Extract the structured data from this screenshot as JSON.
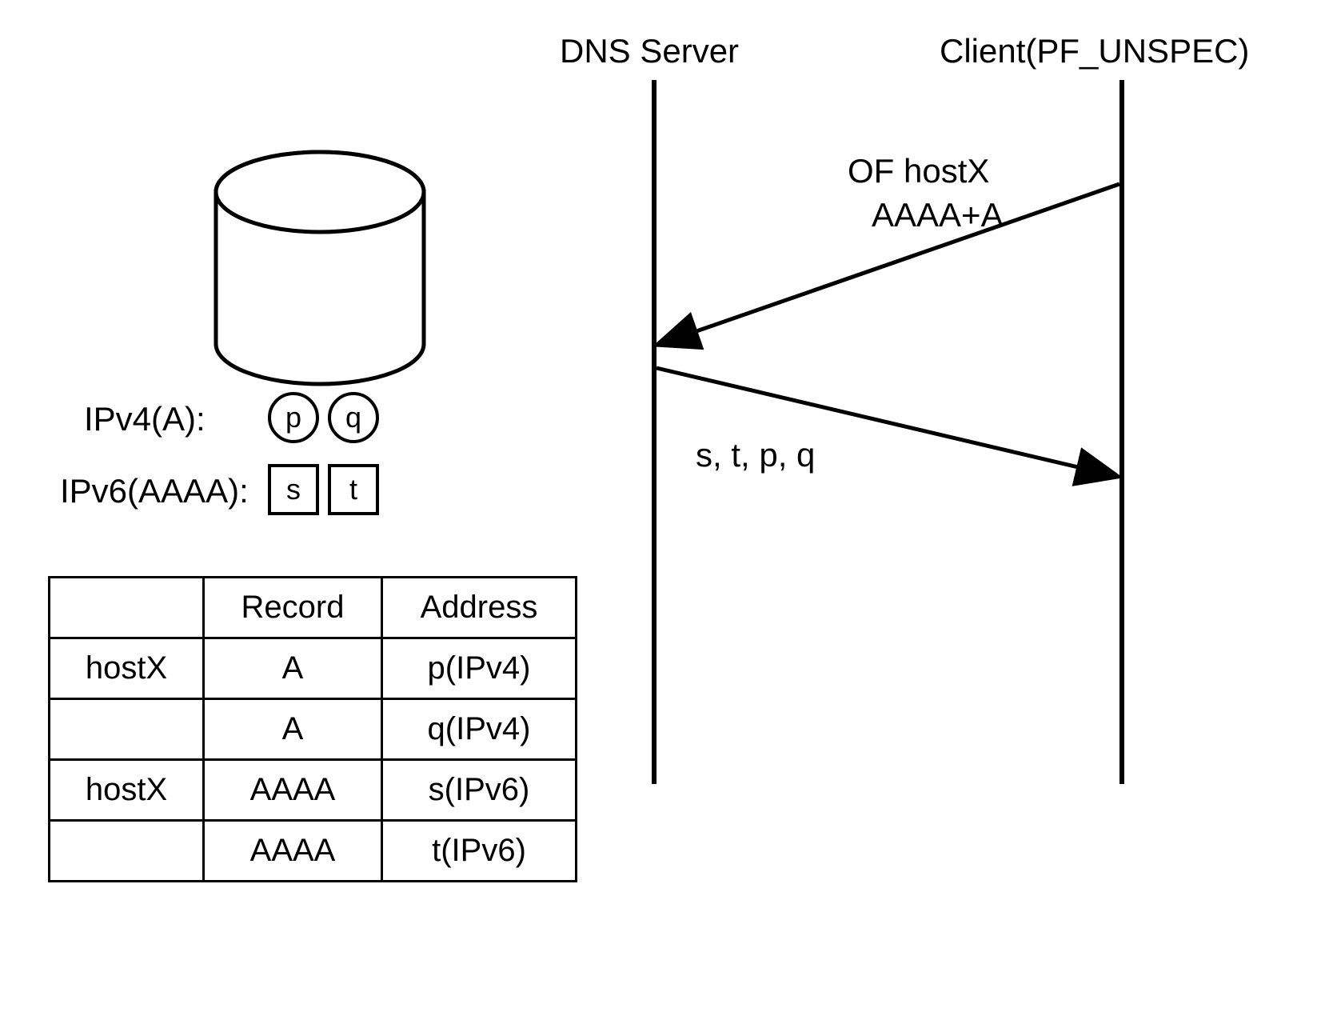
{
  "sequence": {
    "dns_label": "DNS Server",
    "client_label": "Client(PF_UNSPEC)",
    "request_line1": "OF hostX",
    "request_line2": "AAAA+A",
    "response_label": "s, t, p, q"
  },
  "db_labels": {
    "ipv4": "IPv4(A):",
    "ipv6": "IPv6(AAAA):",
    "p": "p",
    "q": "q",
    "s": "s",
    "t": "t"
  },
  "table": {
    "headers": [
      "",
      "Record",
      "Address"
    ],
    "rows": [
      [
        "hostX",
        "A",
        "p(IPv4)"
      ],
      [
        "",
        "A",
        "q(IPv4)"
      ],
      [
        "hostX",
        "AAAA",
        "s(IPv6)"
      ],
      [
        "",
        "AAAA",
        "t(IPv6)"
      ]
    ]
  }
}
